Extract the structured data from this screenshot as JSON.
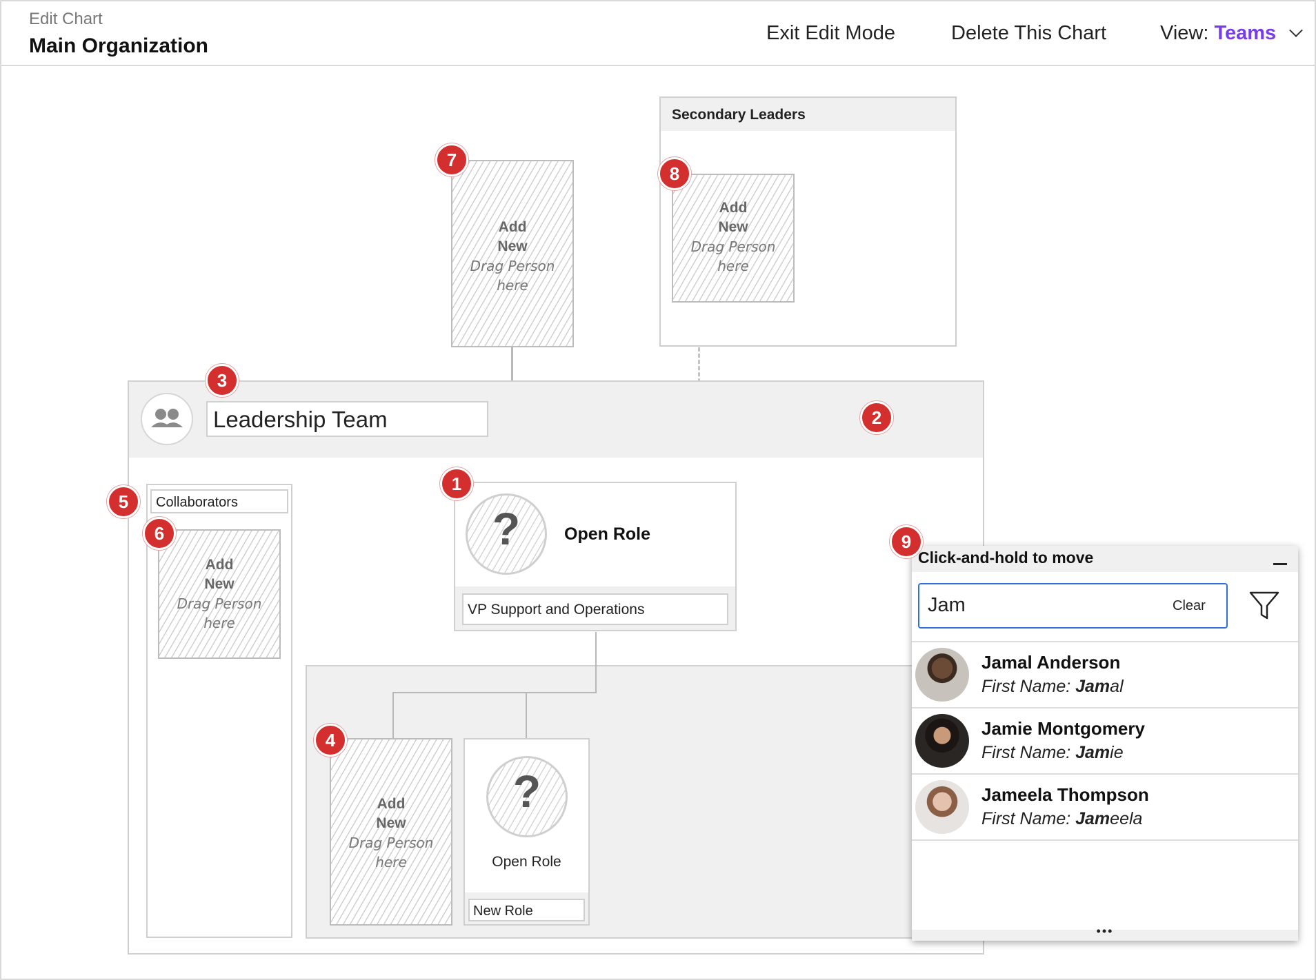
{
  "header": {
    "breadcrumb": "Edit Chart",
    "title": "Main Organization",
    "exit_edit": "Exit Edit Mode",
    "delete_chart": "Delete This Chart",
    "view_label": "View:",
    "view_value": "Teams"
  },
  "colors": {
    "accent": "#7a3be8",
    "badge": "#d32f2f",
    "focus_border": "#2f6fdb"
  },
  "placeholders": {
    "add": "Add",
    "new": "New",
    "drag": "Drag Person",
    "here": "here"
  },
  "secondary_leaders": {
    "title": "Secondary Leaders"
  },
  "team": {
    "name": "Leadership Team",
    "icon": "team-icon"
  },
  "open_role_main": {
    "title": "Open Role",
    "subtitle": "VP Support and Operations"
  },
  "collaborators": {
    "label": "Collaborators"
  },
  "open_role_sub": {
    "title": "Open Role",
    "subtitle": "New Role"
  },
  "search_panel": {
    "title": "Click-and-hold to move",
    "query": "Jam",
    "clear": "Clear",
    "more": "•••",
    "results": [
      {
        "name": "Jamal Anderson",
        "prefix": "First Name: ",
        "match": "Jam",
        "rest": "al"
      },
      {
        "name": "Jamie Montgomery",
        "prefix": "First Name: ",
        "match": "Jam",
        "rest": "ie"
      },
      {
        "name": "Jameela Thompson",
        "prefix": "First Name: ",
        "match": "Jam",
        "rest": "eela"
      }
    ]
  },
  "badges": [
    "1",
    "2",
    "3",
    "4",
    "5",
    "6",
    "7",
    "8",
    "9"
  ]
}
